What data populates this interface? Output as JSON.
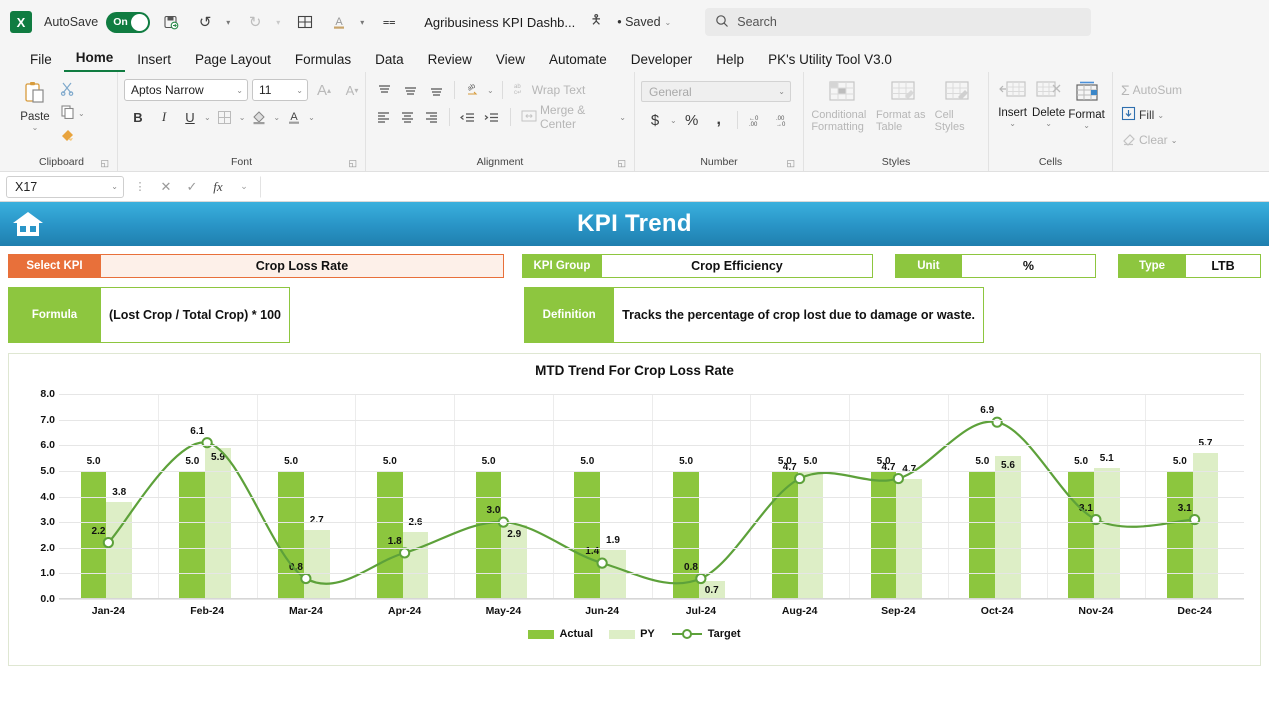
{
  "titlebar": {
    "app_icon": "excel-logo",
    "app_icon_letter": "X",
    "autosave_label": "AutoSave",
    "autosave_state": "On",
    "doc_title": "Agribusiness KPI Dashb...",
    "saved_status": "• Saved",
    "search_placeholder": "Search",
    "quick_access": [
      "save-icon",
      "undo-icon",
      "redo-icon",
      "table-icon",
      "font-color-icon",
      "customize-icon"
    ]
  },
  "ribbon": {
    "tabs": [
      {
        "label": "File",
        "active": false
      },
      {
        "label": "Home",
        "active": true
      },
      {
        "label": "Insert",
        "active": false
      },
      {
        "label": "Page Layout",
        "active": false
      },
      {
        "label": "Formulas",
        "active": false
      },
      {
        "label": "Data",
        "active": false
      },
      {
        "label": "Review",
        "active": false
      },
      {
        "label": "View",
        "active": false
      },
      {
        "label": "Automate",
        "active": false
      },
      {
        "label": "Developer",
        "active": false
      },
      {
        "label": "Help",
        "active": false
      },
      {
        "label": "PK's Utility Tool V3.0",
        "active": false
      }
    ],
    "groups": {
      "clipboard": {
        "label": "Clipboard",
        "paste": "Paste",
        "cut": "cut-scissors-icon",
        "copy": "copy-icon",
        "format_painter": "format-painter-icon"
      },
      "font": {
        "label": "Font",
        "font_name": "Aptos Narrow",
        "font_size": "11",
        "grow_font": "A",
        "shrink_font": "A",
        "bold": "B",
        "italic": "I",
        "underline": "U",
        "borders": "borders-icon",
        "fill_color": "fill-color-icon",
        "font_color": "A"
      },
      "alignment": {
        "label": "Alignment",
        "wrap_text": "Wrap Text",
        "merge_center": "Merge & Center"
      },
      "number": {
        "label": "Number",
        "format": "General",
        "accounting": "$",
        "percent": "%",
        "comma": ",",
        "increase_decimal": "increase-decimal-icon",
        "decrease_decimal": "decrease-decimal-icon"
      },
      "styles": {
        "label": "Styles",
        "conditional_formatting": "Conditional Formatting",
        "format_as_table": "Format as Table",
        "cell_styles": "Cell Styles"
      },
      "cells": {
        "label": "Cells",
        "insert": "Insert",
        "delete": "Delete",
        "format": "Format"
      },
      "editing": {
        "autosum": "AutoSum",
        "fill": "Fill",
        "clear": "Clear"
      }
    }
  },
  "formula_bar": {
    "name_box": "X17",
    "cancel_icon": "cancel-icon",
    "enter_icon": "enter-icon",
    "fx_icon": "fx",
    "formula_value": ""
  },
  "dashboard": {
    "home_icon": "home-icon",
    "banner_title": "KPI Trend",
    "fields": [
      {
        "label": "Select KPI",
        "value": "Crop Loss Rate"
      },
      {
        "label": "KPI Group",
        "value": "Crop Efficiency"
      },
      {
        "label": "Unit",
        "value": "%"
      },
      {
        "label": "Type",
        "value": "LTB"
      }
    ],
    "formula": {
      "label": "Formula",
      "value": "(Lost Crop / Total Crop) * 100"
    },
    "definition": {
      "label": "Definition",
      "value": "Tracks the percentage of crop lost due to damage or waste."
    },
    "colors": {
      "select_kpi_accent": "#e8703a",
      "select_kpi_fill": "#fdf0e9",
      "green_accent": "#8dc63f",
      "banner_blue": "#2a96c8",
      "bar_actual": "#8cc63e",
      "bar_py": "#ddeec6",
      "target_line": "#5da13a"
    }
  },
  "chart_data": {
    "type": "bar",
    "title": "MTD Trend For Crop Loss Rate",
    "xlabel": "",
    "ylabel": "",
    "ylim": [
      0,
      8
    ],
    "ytick_values": [
      0.0,
      1.0,
      2.0,
      3.0,
      4.0,
      5.0,
      6.0,
      7.0,
      8.0
    ],
    "ytick_labels": [
      "0.0",
      "1.0",
      "2.0",
      "3.0",
      "4.0",
      "5.0",
      "6.0",
      "7.0",
      "8.0"
    ],
    "grid": true,
    "legend_position": "bottom",
    "categories": [
      "Jan-24",
      "Feb-24",
      "Mar-24",
      "Apr-24",
      "May-24",
      "Jun-24",
      "Jul-24",
      "Aug-24",
      "Sep-24",
      "Oct-24",
      "Nov-24",
      "Dec-24"
    ],
    "series": [
      {
        "name": "Actual",
        "kind": "bar",
        "values": [
          5.0,
          5.0,
          5.0,
          5.0,
          5.0,
          5.0,
          5.0,
          5.0,
          5.0,
          5.0,
          5.0,
          5.0
        ],
        "labels": [
          "5.0",
          "5.0",
          "5.0",
          "5.0",
          "5.0",
          "5.0",
          "5.0",
          "5.0",
          "5.0",
          "5.0",
          "5.0",
          "5.0"
        ]
      },
      {
        "name": "PY",
        "kind": "bar",
        "values": [
          3.8,
          5.9,
          2.7,
          2.6,
          2.9,
          1.9,
          0.7,
          5.0,
          4.7,
          5.6,
          5.1,
          5.7
        ],
        "labels": [
          "3.8",
          "5.9",
          "2.7",
          "2.6",
          "2.9",
          "1.9",
          "0.7",
          "5.0",
          "4.7",
          "5.6",
          "5.1",
          "5.7"
        ]
      },
      {
        "name": "Target",
        "kind": "line",
        "values": [
          2.2,
          6.1,
          0.8,
          1.8,
          3.0,
          1.4,
          0.8,
          4.7,
          4.7,
          6.9,
          3.1,
          3.1
        ],
        "labels": [
          "2.2",
          "6.1",
          "0.8",
          "1.8",
          "3.0",
          "1.4",
          "0.8",
          "4.7",
          "4.7",
          "6.9",
          "3.1",
          "3.1"
        ]
      }
    ]
  }
}
